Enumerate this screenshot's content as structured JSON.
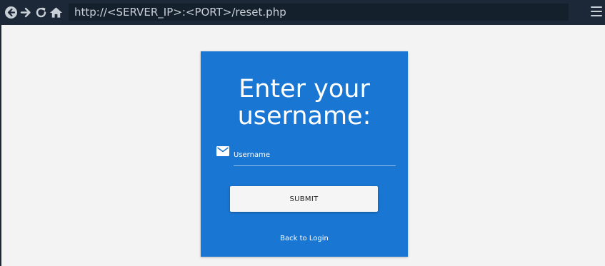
{
  "browser": {
    "url": "http://<SERVER_IP>:<PORT>/reset.php",
    "icons": [
      "back-icon",
      "forward-icon",
      "reload-icon",
      "home-icon",
      "menu-icon"
    ]
  },
  "card": {
    "title_line1": "Enter your",
    "title_line2": "username:",
    "username_label": "Username",
    "submit_label": "SUBMIT",
    "back_link": "Back to Login"
  },
  "colors": {
    "toolbar": "#1c2837",
    "page_background": "#f3f3f3",
    "card_background": "#1976d2",
    "button_background": "#f5f5f5"
  }
}
